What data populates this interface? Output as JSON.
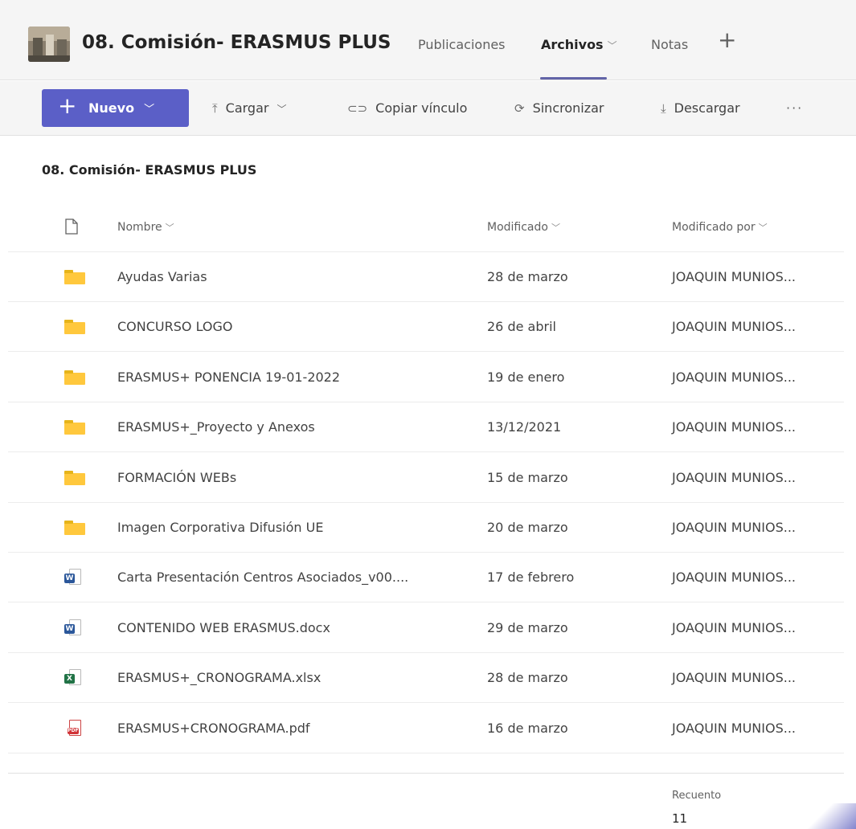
{
  "header": {
    "team_name": "08. Comisión- ERASMUS PLUS",
    "tabs": [
      {
        "label": "Publicaciones"
      },
      {
        "label": "Archivos"
      },
      {
        "label": "Notas"
      }
    ],
    "add_tab_icon": "plus-icon"
  },
  "toolbar": {
    "new_label": "Nuevo",
    "upload_label": "Cargar",
    "copy_link_label": "Copiar vínculo",
    "sync_label": "Sincronizar",
    "download_label": "Descargar",
    "more_label": "···"
  },
  "breadcrumb": "08. Comisión- ERASMUS PLUS",
  "columns": {
    "name": "Nombre",
    "modified": "Modificado",
    "modified_by": "Modificado por"
  },
  "files": [
    {
      "type": "folder",
      "name": "Ayudas Varias",
      "modified": "28 de marzo",
      "modified_by": "JOAQUIN MUNIOS..."
    },
    {
      "type": "folder",
      "name": "CONCURSO LOGO",
      "modified": "26 de abril",
      "modified_by": "JOAQUIN MUNIOS..."
    },
    {
      "type": "folder",
      "name": "ERASMUS+ PONENCIA 19-01-2022",
      "modified": "19 de enero",
      "modified_by": "JOAQUIN MUNIOS..."
    },
    {
      "type": "folder",
      "name": "ERASMUS+_Proyecto y Anexos",
      "modified": "13/12/2021",
      "modified_by": "JOAQUIN MUNIOS..."
    },
    {
      "type": "folder",
      "name": "FORMACIÓN WEBs",
      "modified": "15 de marzo",
      "modified_by": "JOAQUIN MUNIOS..."
    },
    {
      "type": "folder",
      "name": "Imagen Corporativa Difusión UE",
      "modified": "20 de marzo",
      "modified_by": "JOAQUIN MUNIOS..."
    },
    {
      "type": "word",
      "name": "Carta Presentación Centros Asociados_v00....",
      "modified": "17 de febrero",
      "modified_by": "JOAQUIN MUNIOS..."
    },
    {
      "type": "word",
      "name": "CONTENIDO WEB ERASMUS.docx",
      "modified": "29 de marzo",
      "modified_by": "JOAQUIN MUNIOS..."
    },
    {
      "type": "excel",
      "name": "ERASMUS+_CRONOGRAMA.xlsx",
      "modified": "28 de marzo",
      "modified_by": "JOAQUIN MUNIOS..."
    },
    {
      "type": "pdf",
      "name": "ERASMUS+CRONOGRAMA.pdf",
      "modified": "16 de marzo",
      "modified_by": "JOAQUIN MUNIOS..."
    }
  ],
  "footer": {
    "count_label": "Recuento",
    "count_value": "11"
  },
  "colors": {
    "accent": "#5b5fc7",
    "tab_underline": "#6264a7",
    "folder": "#ffc83d",
    "word": "#2b579a",
    "excel": "#217346",
    "pdf": "#d13438"
  }
}
